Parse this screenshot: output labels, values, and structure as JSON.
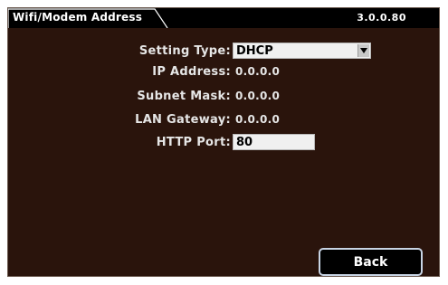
{
  "header": {
    "tab_title": "Wifi/Modem Address",
    "version": "3.0.0.80"
  },
  "form": {
    "setting_type": {
      "label": "Setting Type:",
      "value": "DHCP"
    },
    "ip_address": {
      "label": "IP Address:",
      "value": "0.0.0.0"
    },
    "subnet_mask": {
      "label": "Subnet Mask:",
      "value": "0.0.0.0"
    },
    "lan_gateway": {
      "label": "LAN Gateway:",
      "value": "0.0.0.0"
    },
    "http_port": {
      "label": "HTTP Port:",
      "value": "80"
    }
  },
  "footer": {
    "back_label": "Back"
  },
  "colors": {
    "background": "#2a140c",
    "topbar": "#000000",
    "text": "#e6e6e6",
    "button_border": "#c8d4e4"
  },
  "icons": {
    "dropdown": "chevron-down-icon"
  }
}
